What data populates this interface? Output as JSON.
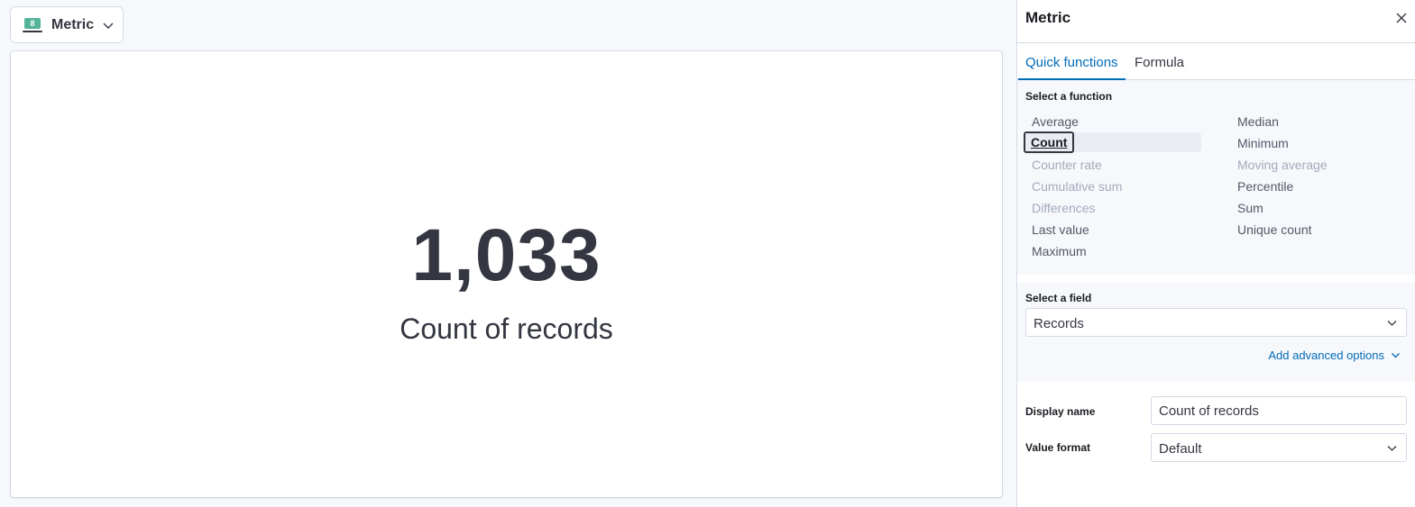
{
  "switcher": {
    "label": "Metric",
    "icon": "metric-vis-icon",
    "icon_digit": "8"
  },
  "metric": {
    "value": "1,033",
    "title": "Count of records"
  },
  "flyout": {
    "title": "Metric",
    "tabs": [
      {
        "label": "Quick functions",
        "active": true
      },
      {
        "label": "Formula",
        "active": false
      }
    ],
    "function_section_label": "Select a function",
    "functions_left": [
      {
        "label": "Average",
        "enabled": true
      },
      {
        "label": "Count",
        "enabled": true,
        "selected": true
      },
      {
        "label": "Counter rate",
        "enabled": false
      },
      {
        "label": "Cumulative sum",
        "enabled": false
      },
      {
        "label": "Differences",
        "enabled": false
      },
      {
        "label": "Last value",
        "enabled": true
      },
      {
        "label": "Maximum",
        "enabled": true
      }
    ],
    "functions_right": [
      {
        "label": "Median",
        "enabled": true
      },
      {
        "label": "Minimum",
        "enabled": true
      },
      {
        "label": "Moving average",
        "enabled": false
      },
      {
        "label": "Percentile",
        "enabled": true
      },
      {
        "label": "Sum",
        "enabled": true
      },
      {
        "label": "Unique count",
        "enabled": true
      }
    ],
    "field_section_label": "Select a field",
    "field_value": "Records",
    "advanced_link": "Add advanced options",
    "display_name_label": "Display name",
    "display_name_value": "Count of records",
    "value_format_label": "Value format",
    "value_format_value": "Default"
  },
  "colors": {
    "accent": "#006bb8",
    "metric_icon": "#54b399",
    "text": "#343741",
    "disabled": "#a2abba"
  }
}
